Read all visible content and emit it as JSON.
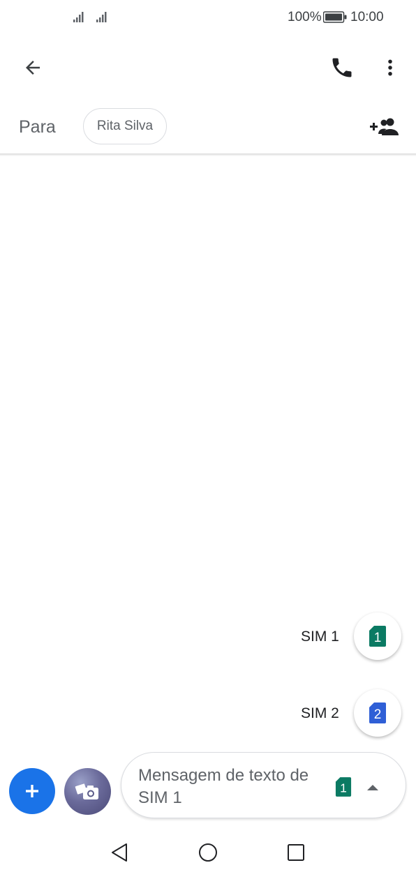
{
  "status_bar": {
    "battery_percent": "100%",
    "time": "10:00",
    "icons": [
      "signal-sim1-icon",
      "signal-sim2-icon",
      "battery-icon"
    ]
  },
  "header": {
    "icons": [
      "back-arrow-icon",
      "phone-icon",
      "more-vert-icon"
    ]
  },
  "recipients": {
    "label": "Para",
    "chips": [
      "Rita Silva"
    ],
    "add_icon": "add-group-icon"
  },
  "sim_picker": {
    "options": [
      {
        "label": "SIM 1",
        "number": "1",
        "color": "#0b7a63"
      },
      {
        "label": "SIM 2",
        "number": "2",
        "color": "#2f5fd6"
      }
    ]
  },
  "compose": {
    "placeholder": "Mensagem de texto de SIM 1",
    "sim_number": "1",
    "sim_color": "#0b7a63",
    "accent": "#1a73e8",
    "icons": [
      "plus-icon",
      "camera-gallery-icon",
      "caret-up-icon"
    ]
  },
  "nav_bar": {
    "icons": [
      "back-triangle-icon",
      "home-circle-icon",
      "recents-square-icon"
    ]
  }
}
